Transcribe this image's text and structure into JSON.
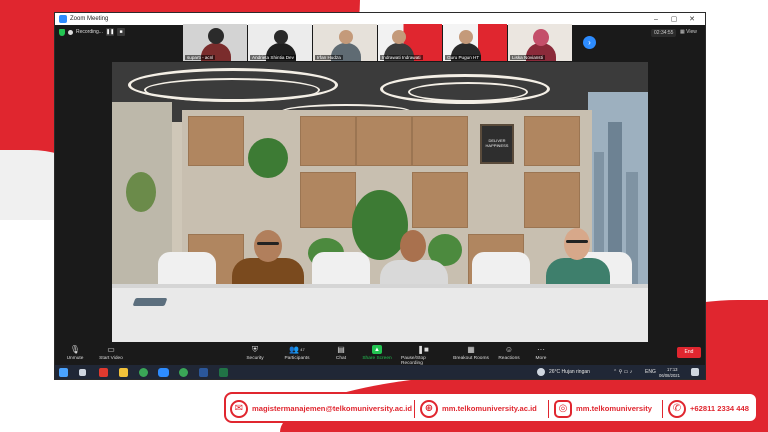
{
  "window": {
    "title": "Zoom Meeting",
    "controls": [
      "–",
      "▢",
      "✕"
    ]
  },
  "recording": {
    "label": "Recording...",
    "pause_label": "❚❚",
    "stop_label": "■"
  },
  "participants_strip": [
    {
      "name": "suparti - acnl"
    },
    {
      "name": "Andrieta Shintia Dev"
    },
    {
      "name": "Irfan Hudza"
    },
    {
      "name": "Indrawati Indrawati"
    },
    {
      "name": "Guru Pugun HT"
    },
    {
      "name": "Liska Noviansti"
    }
  ],
  "meeting": {
    "timer": "02:34:55",
    "view_label": "View"
  },
  "video_scene": {
    "wall_art_text": "DELIVER HAPPINESS"
  },
  "toolbar": {
    "unmute_label": "Unmute",
    "start_video_label": "Start Video",
    "security_label": "Security",
    "participants_label": "Participants",
    "participants_count": "47",
    "chat_label": "Chat",
    "share_screen_label": "Share Screen",
    "recording_label": "Pause/Stop Recording",
    "breakout_label": "Breakout Rooms",
    "reactions_label": "Reactions",
    "more_label": "More",
    "end_label": "End"
  },
  "taskbar": {
    "weather": "26°C  Hujan ringan",
    "lang": "ENG",
    "time": "17:13",
    "date": "06/08/2021"
  },
  "contacts": {
    "email": "magistermanajemen@telkomuniversity.ac.id",
    "website": "mm.telkomuniversity.ac.id",
    "instagram": "mm.telkomuniversity",
    "phone": "+62811 2334 448"
  },
  "colors": {
    "brand_red": "#e0262f",
    "zoom_blue": "#2d8cff",
    "share_green": "#23c552"
  }
}
